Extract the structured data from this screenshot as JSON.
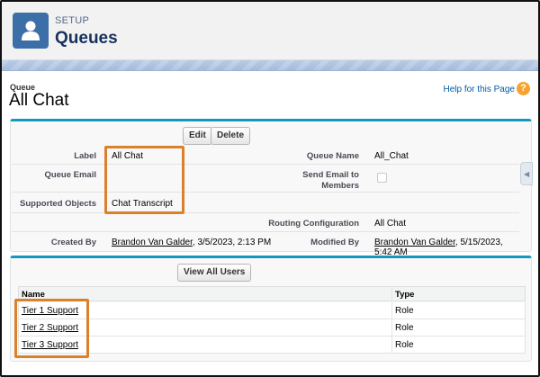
{
  "header": {
    "eyebrow": "SETUP",
    "title": "Queues"
  },
  "page": {
    "type_label": "Queue",
    "title": "All Chat",
    "help_link": "Help for this Page",
    "help_glyph": "?"
  },
  "detail": {
    "edit_button": "Edit",
    "delete_button": "Delete",
    "fields": {
      "label": {
        "name": "Label",
        "value": "All Chat"
      },
      "queue_email": {
        "name": "Queue Email",
        "value": ""
      },
      "supported_objects": {
        "name": "Supported Objects",
        "value": "Chat Transcript"
      },
      "queue_name": {
        "name": "Queue Name",
        "value": "All_Chat"
      },
      "send_email_to_members": {
        "name": "Send Email to Members",
        "checked": false
      },
      "routing_configuration": {
        "name": "Routing Configuration",
        "value": "All Chat"
      },
      "created_by": {
        "name": "Created By",
        "user": "Brandon Van Galder",
        "date": ", 3/5/2023, 2:13 PM"
      },
      "modified_by": {
        "name": "Modified By",
        "user": "Brandon Van Galder",
        "date": ", 5/15/2023, 5:42 AM"
      }
    }
  },
  "members": {
    "view_all_button": "View All Users",
    "columns": [
      "Name",
      "Type"
    ],
    "rows": [
      {
        "name": "Tier 1 Support",
        "type": "Role"
      },
      {
        "name": "Tier 2 Support",
        "type": "Role"
      },
      {
        "name": "Tier 3 Support",
        "type": "Role"
      }
    ]
  },
  "colors": {
    "brand_blue": "#3c6fa8",
    "panel_accent": "#1797c0",
    "highlight_orange": "#d9822b",
    "link_blue": "#015ba7"
  },
  "icons": {
    "setup": "user-icon",
    "help": "help-icon",
    "side_tab": "chevron-left-icon"
  }
}
